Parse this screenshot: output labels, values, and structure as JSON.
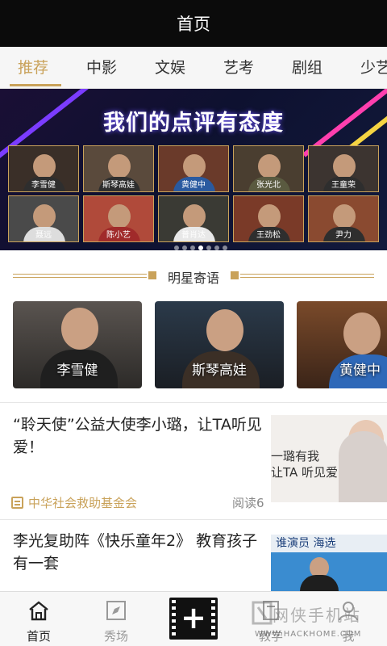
{
  "header": {
    "title": "首页"
  },
  "tabs": [
    {
      "label": "推荐",
      "active": true
    },
    {
      "label": "中影",
      "active": false
    },
    {
      "label": "文娱",
      "active": false
    },
    {
      "label": "艺考",
      "active": false
    },
    {
      "label": "剧组",
      "active": false
    },
    {
      "label": "少艺",
      "active": false
    }
  ],
  "banner": {
    "title": "我们的点评有态度",
    "names": [
      "李雪健",
      "斯琴高娃",
      "黄健中",
      "张光北",
      "王童荣",
      "聂远",
      "陈小艺",
      "普肖达",
      "王劲松",
      "尹力"
    ]
  },
  "section": {
    "title": "明星寄语"
  },
  "stars": [
    {
      "name": "李雪健"
    },
    {
      "name": "斯琴高娃"
    },
    {
      "name": "黄健中"
    }
  ],
  "articles": [
    {
      "title": "“聆天使”公益大使李小璐，让TA听见爱！",
      "source": "中华社会救助基金会",
      "reads": "阅读6",
      "thumb_text": [
        "一璐有我",
        "让TA 听见爱"
      ]
    },
    {
      "title": "李光复助阵《快乐童年2》 教育孩子有一套",
      "thumb_text": [
        "谁演员 海选"
      ]
    }
  ],
  "bottom_nav": [
    {
      "label": "首页",
      "icon": "home-icon",
      "active": true
    },
    {
      "label": "秀场",
      "icon": "compass-icon",
      "active": false
    },
    {
      "label": "",
      "icon": "plus-film-icon",
      "active": false
    },
    {
      "label": "教学",
      "icon": "book-icon",
      "active": false
    },
    {
      "label": "我",
      "icon": "person-icon",
      "active": false
    }
  ],
  "watermark": {
    "text": "网侠手机站",
    "url": "WWW.HACKHOME.COM"
  },
  "colors": {
    "accent": "#c9a25a",
    "titlebar": "#0b0b0b",
    "banner_bg": "#0e1130"
  }
}
